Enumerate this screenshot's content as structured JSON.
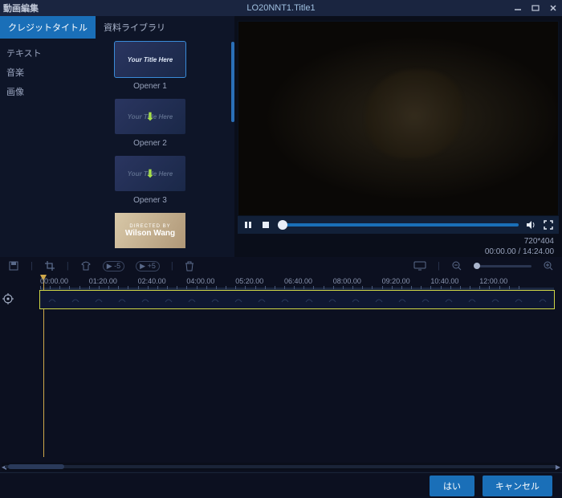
{
  "titlebar": {
    "app_name": "動画編集",
    "doc_title": "LO20NNT1.Title1"
  },
  "tabs": {
    "credits": "クレジットタイトル",
    "library": "資料ライブラリ"
  },
  "sidenav": {
    "text": "テキスト",
    "music": "音楽",
    "image": "画像"
  },
  "thumbs": {
    "title_placeholder": "Your Title Here",
    "opener1": "Opener 1",
    "opener2": "Opener 2",
    "opener3": "Opener 3",
    "item4_line1": "DIRECTED BY",
    "item4_line2": "Wilson Wang"
  },
  "player": {
    "resolution": "720*404",
    "time": "00:00.00 / 14:24.00"
  },
  "toolbar": {
    "minus5": "▶ -5",
    "plus5": "▶ +5"
  },
  "ruler": [
    "00:00.00",
    "01:20.00",
    "02:40.00",
    "04:00.00",
    "05:20.00",
    "06:40.00",
    "08:00.00",
    "09:20.00",
    "10:40.00",
    "12:00.00"
  ],
  "footer": {
    "ok": "はい",
    "cancel": "キャンセル"
  }
}
